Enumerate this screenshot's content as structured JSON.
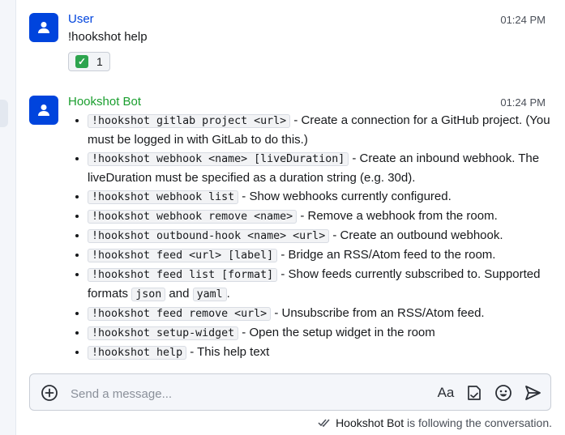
{
  "messages": [
    {
      "sender": "User",
      "sender_color": "#0044dd",
      "timestamp": "01:24 PM",
      "body": "!hookshot help",
      "reaction": {
        "emoji": "check-mark-icon",
        "count": "1"
      }
    },
    {
      "sender": "Hookshot Bot",
      "sender_color": "#1a9e2e",
      "timestamp": "01:24 PM",
      "help_items": [
        {
          "cmd": "!hookshot gitlab project <url>",
          "desc": " - Create a connection for a GitHub project. (You must be logged in with GitLab to do this.)"
        },
        {
          "cmd": "!hookshot webhook <name> [liveDuration]",
          "desc": " - Create an inbound webhook. The liveDuration must be specified as a duration string (e.g. 30d)."
        },
        {
          "cmd": "!hookshot webhook list",
          "desc": " - Show webhooks currently configured."
        },
        {
          "cmd": "!hookshot webhook remove <name>",
          "desc": " - Remove a webhook from the room."
        },
        {
          "cmd": "!hookshot outbound-hook <name> <url>",
          "desc": " - Create an outbound webhook."
        },
        {
          "cmd": "!hookshot feed <url> [label]",
          "desc": " - Bridge an RSS/Atom feed to the room."
        },
        {
          "cmd": "!hookshot feed list [format]",
          "desc": " - Show feeds currently subscribed to. Supported formats ",
          "extra": {
            "code1": "json",
            "mid": " and ",
            "code2": "yaml",
            "end": "."
          }
        },
        {
          "cmd": "!hookshot feed remove <url>",
          "desc": " - Unsubscribe from an RSS/Atom feed."
        },
        {
          "cmd": "!hookshot setup-widget",
          "desc": " - Open the setup widget in the room"
        },
        {
          "cmd": "!hookshot help",
          "desc": " - This help text"
        }
      ]
    }
  ],
  "composer": {
    "placeholder": "Send a message...",
    "icons": [
      "add-circle-icon",
      "text-format-icon",
      "attachment-icon",
      "emoji-icon",
      "send-icon"
    ],
    "format_label": "Aa"
  },
  "following": {
    "name": "Hookshot Bot",
    "text": " is following the conversation."
  }
}
